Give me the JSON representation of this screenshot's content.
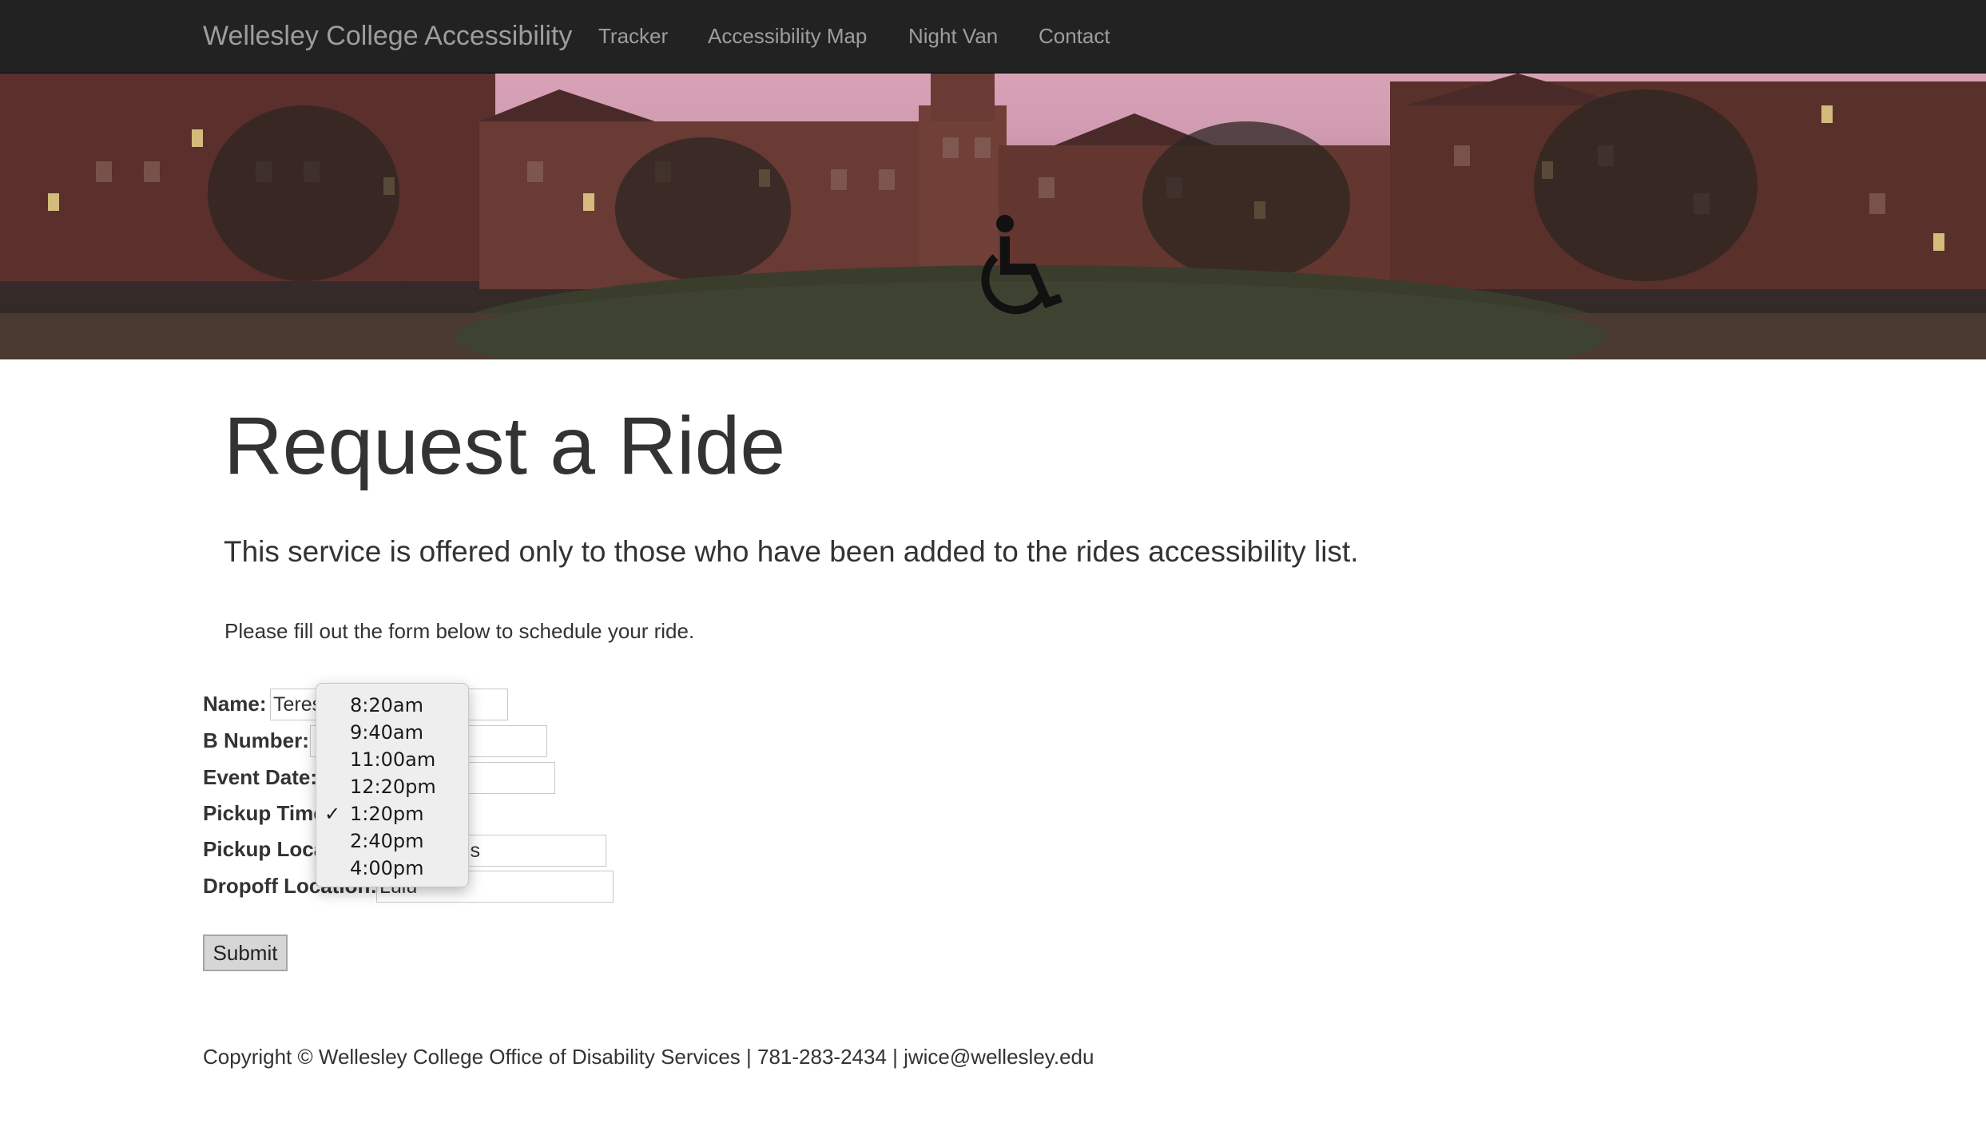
{
  "navbar": {
    "brand": "Wellesley College Accessibility",
    "links": [
      "Tracker",
      "Accessibility Map",
      "Night Van",
      "Contact"
    ]
  },
  "banner": {
    "accessibility_symbol": "wheelchair-icon"
  },
  "main": {
    "title": "Request a Ride",
    "lead": "This service is offered only to those who have been added to the rides accessibility list.",
    "intro": "Please fill out the form below to schedule your ride."
  },
  "form": {
    "fields": {
      "name": {
        "label": "Name:",
        "value": "Teres"
      },
      "b_number": {
        "label": "B Number:",
        "value": ""
      },
      "event_date": {
        "label": "Event Date:",
        "value": ""
      },
      "pickup_time": {
        "label": "Pickup Time",
        "selected": "1:20pm"
      },
      "pickup_location": {
        "label": "Pickup Loca",
        "value": "is"
      },
      "dropoff_location": {
        "label": "Dropoff Location:",
        "value": "Lulu"
      }
    },
    "submit_label": "Submit",
    "pickup_time_dropdown": {
      "options": [
        "8:20am",
        "9:40am",
        "11:00am",
        "12:20pm",
        "1:20pm",
        "2:40pm",
        "4:00pm"
      ],
      "checkmark": "✓",
      "selected_index": 4
    }
  },
  "footer": {
    "text": "Copyright © Wellesley College Office of Disability Services | 781-283-2434 | jwice@wellesley.edu"
  },
  "colors": {
    "navbar_bg": "#222222",
    "navbar_text": "#9d9d9d",
    "body_text": "#333333",
    "dropdown_bg": "#eeeeee"
  }
}
